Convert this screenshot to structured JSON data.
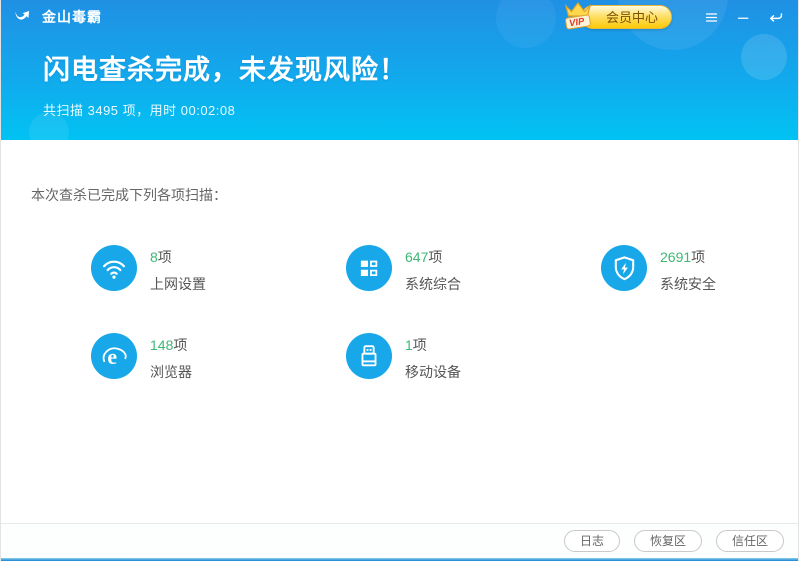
{
  "app": {
    "title": "金山毒霸"
  },
  "titlebar": {
    "vip_button_label": "会员中心",
    "vip_badge": "VIP"
  },
  "header": {
    "title": "闪电查杀完成，未发现风险！",
    "subtitle": "共扫描 3495 项，用时 00:02:08"
  },
  "content": {
    "section_title": "本次查杀已完成下列各项扫描：",
    "items": [
      {
        "icon": "wifi-icon",
        "count": "8",
        "unit": "项",
        "label": "上网设置"
      },
      {
        "icon": "grid-icon",
        "count": "647",
        "unit": "项",
        "label": "系统综合"
      },
      {
        "icon": "shield-icon",
        "count": "2691",
        "unit": "项",
        "label": "系统安全"
      },
      {
        "icon": "browser-icon",
        "count": "148",
        "unit": "项",
        "label": "浏览器"
      },
      {
        "icon": "usb-icon",
        "count": "1",
        "unit": "项",
        "label": "移动设备"
      }
    ]
  },
  "footer": {
    "buttons": [
      {
        "label": "日志"
      },
      {
        "label": "恢复区"
      },
      {
        "label": "信任区"
      }
    ]
  },
  "colors": {
    "header_gradient_top": "#2090e4",
    "header_gradient_bottom": "#01c3f3",
    "icon_circle": "#18a7e8",
    "count_green": "#3db874",
    "vip_gold": "#fdc908",
    "bottom_accent": "#1583d6"
  }
}
